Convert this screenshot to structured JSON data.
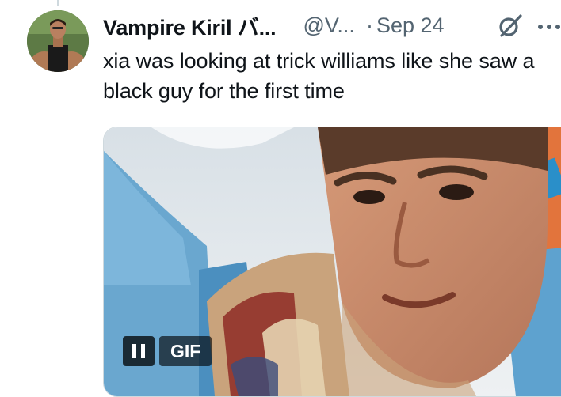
{
  "tweet": {
    "author": {
      "display_name": "Vampire Kiril バ...",
      "handle": "@V...",
      "avatar_icon": "profile-avatar"
    },
    "separator": "·",
    "date": "Sep 24",
    "text": "xia was looking at trick williams like she saw a black guy for the first time",
    "media": {
      "type": "gif",
      "badge_label": "GIF",
      "pause_icon": "pause-icon"
    },
    "actions": {
      "grok_icon": "grok-icon",
      "more_icon": "more-icon"
    }
  },
  "colors": {
    "text_primary": "#0f1419",
    "text_secondary": "#536471",
    "border": "#cfd9de"
  }
}
